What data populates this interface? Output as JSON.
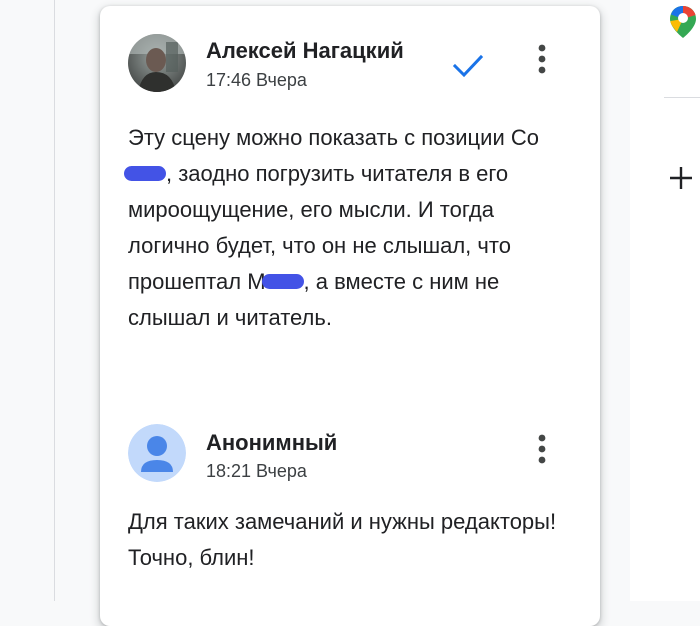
{
  "comments": [
    {
      "author": "Алексей Нагацкий",
      "time": "17:46 Вчера",
      "resolved_icon": "check-icon",
      "menu_icon": "more-vert-icon",
      "text_parts": [
        "Эту сцену можно показать с позиции Со",
        ", заодно погрузить читателя в его мироощущение, его мысли. И тогда логично будет, что он не слышал, что прошептал М",
        ", а вместе с ним не слышал и читатель."
      ]
    },
    {
      "author": "Анонимный",
      "time": "18:21 Вчера",
      "menu_icon": "more-vert-icon",
      "text": "Для таких замечаний и нужны редакторы! Точно, блин!"
    }
  ],
  "side_panel": {
    "icons": [
      "maps-icon",
      "plus-icon"
    ]
  },
  "colors": {
    "check": "#1a73e8",
    "redaction": "#4353e6",
    "anon_avatar_bg": "#c2d9fb",
    "anon_avatar_fg": "#4a86e8"
  }
}
